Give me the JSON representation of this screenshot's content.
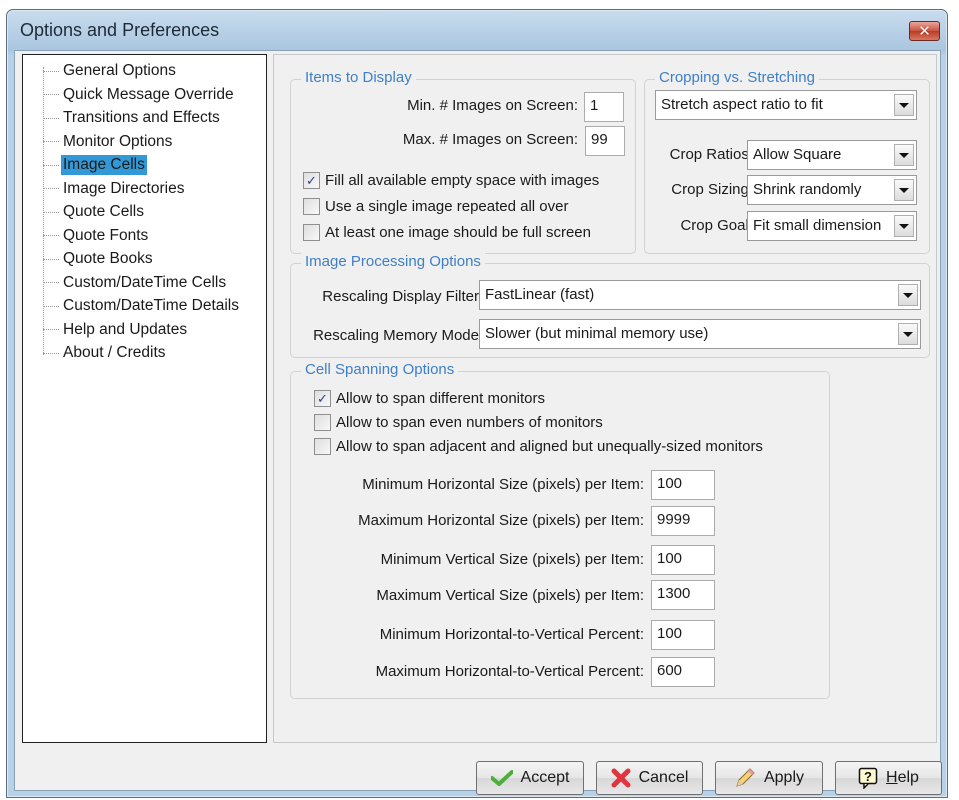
{
  "window": {
    "title": "Options and Preferences",
    "close_icon": "close-icon"
  },
  "sidebar": {
    "items": [
      {
        "label": "General Options",
        "selected": false
      },
      {
        "label": "Quick Message Override",
        "selected": false
      },
      {
        "label": "Transitions and Effects",
        "selected": false
      },
      {
        "label": "Monitor Options",
        "selected": false
      },
      {
        "label": "Image Cells",
        "selected": true
      },
      {
        "label": "Image Directories",
        "selected": false
      },
      {
        "label": "Quote Cells",
        "selected": false
      },
      {
        "label": "Quote Fonts",
        "selected": false
      },
      {
        "label": "Quote Books",
        "selected": false
      },
      {
        "label": "Custom/DateTime Cells",
        "selected": false
      },
      {
        "label": "Custom/DateTime Details",
        "selected": false
      },
      {
        "label": "Help and Updates",
        "selected": false
      },
      {
        "label": "About / Credits",
        "selected": false
      }
    ]
  },
  "items_to_display": {
    "title": "Items to Display",
    "min_label": "Min. # Images on Screen:",
    "min_value": "1",
    "max_label": "Max. # Images on Screen:",
    "max_value": "99",
    "checkboxes": [
      {
        "label": "Fill all available empty space with images",
        "checked": true
      },
      {
        "label": "Use a single image repeated all over",
        "checked": false
      },
      {
        "label": "At least one image should be full screen",
        "checked": false
      }
    ]
  },
  "cropping": {
    "title": "Cropping vs. Stretching",
    "mode_value": "Stretch aspect ratio to fit",
    "ratios_label": "Crop Ratios:",
    "ratios_value": "Allow Square",
    "sizing_label": "Crop Sizing:",
    "sizing_value": "Shrink randomly",
    "goal_label": "Crop Goal:",
    "goal_value": "Fit small dimension"
  },
  "image_processing": {
    "title": "Image Processing Options",
    "filter_label": "Rescaling Display Filter",
    "filter_value": "FastLinear (fast)",
    "memory_label": "Rescaling Memory Mode",
    "memory_value": "Slower (but minimal memory use)"
  },
  "cell_spanning": {
    "title": "Cell Spanning Options",
    "checkboxes": [
      {
        "label": "Allow to span different monitors",
        "checked": true
      },
      {
        "label": "Allow to span even numbers of monitors",
        "checked": false
      },
      {
        "label": "Allow to span adjacent and aligned but unequally-sized monitors",
        "checked": false
      }
    ],
    "fields": [
      {
        "label": "Minimum Horizontal Size (pixels) per Item:",
        "value": "100"
      },
      {
        "label": "Maximum Horizontal Size (pixels) per Item:",
        "value": "9999"
      },
      {
        "label": "Minimum Vertical Size (pixels) per Item:",
        "value": "100"
      },
      {
        "label": "Maximum Vertical Size (pixels) per Item:",
        "value": "1300"
      },
      {
        "label": "Minimum Horizontal-to-Vertical  Percent:",
        "value": "100"
      },
      {
        "label": "Maximum Horizontal-to-Vertical  Percent:",
        "value": "600"
      }
    ]
  },
  "buttons": {
    "accept": {
      "label": "Accept",
      "icon": "checkmark-icon"
    },
    "cancel": {
      "label": "Cancel",
      "icon": "red-x-icon"
    },
    "apply": {
      "label": "Apply",
      "icon": "pencil-icon"
    },
    "help": {
      "label_prefix": "H",
      "label_rest": "elp",
      "icon": "help-icon"
    }
  },
  "colors": {
    "group_title": "#3f7fc8",
    "selection": "#3399d6",
    "close_button": "#c9523f"
  }
}
